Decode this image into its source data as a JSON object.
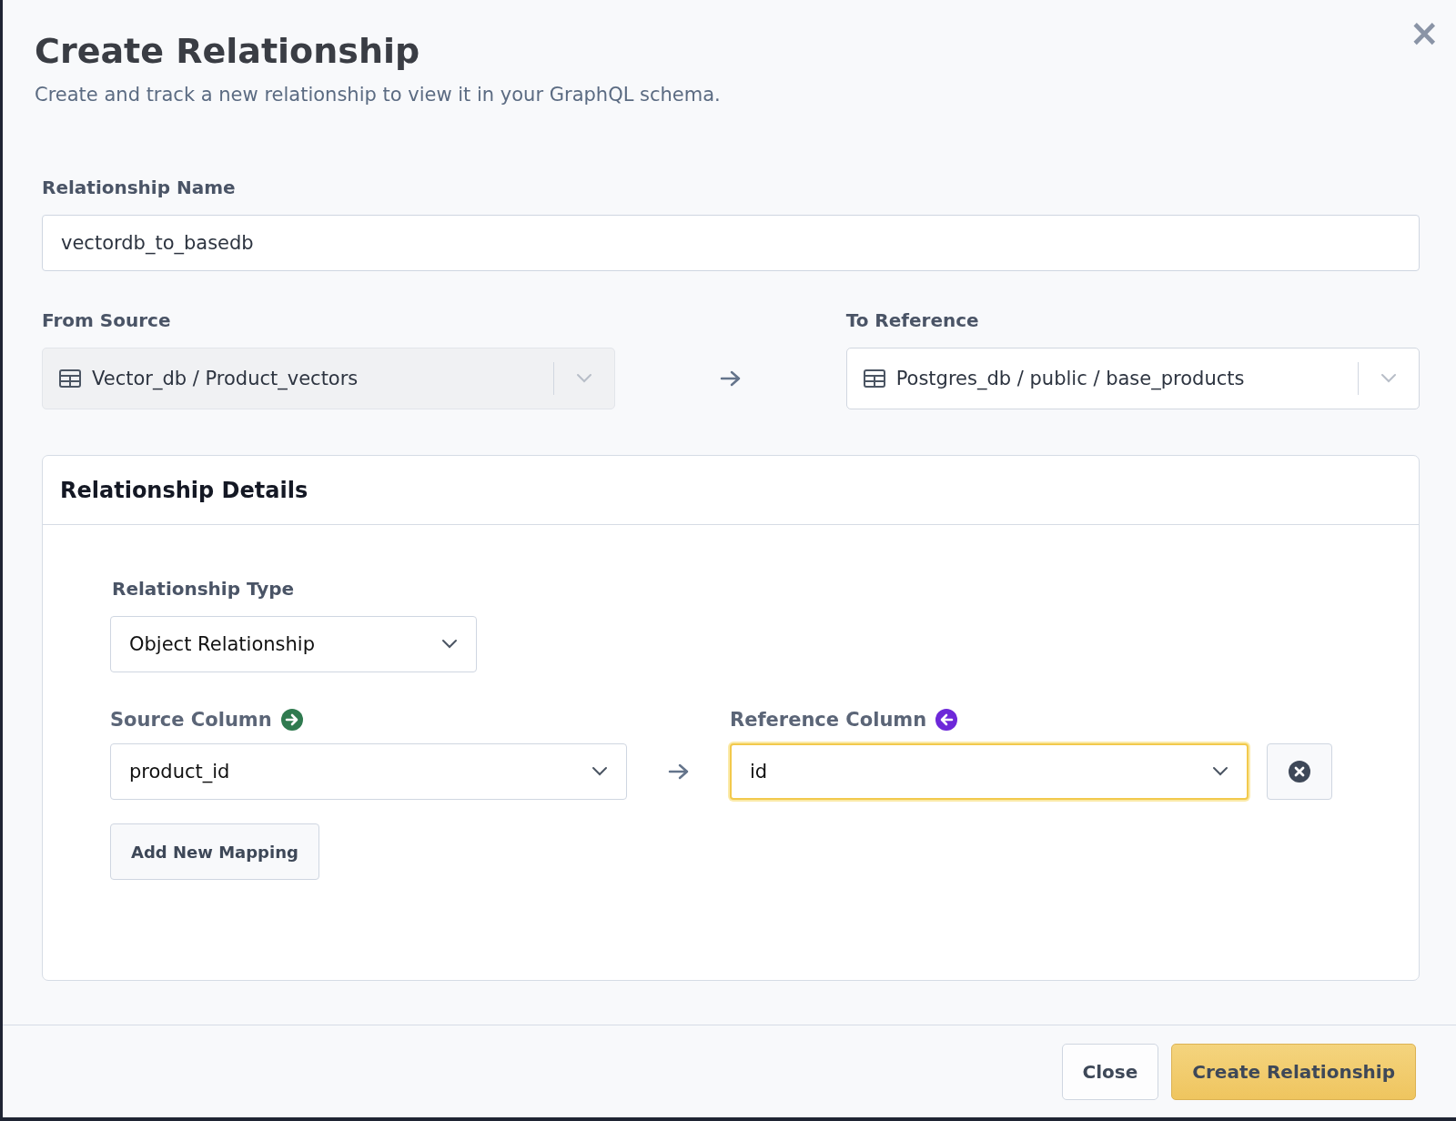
{
  "dialog": {
    "title": "Create Relationship",
    "subtitle": "Create and track a new relationship to view it in your GraphQL schema.",
    "close_icon": "×"
  },
  "relationship_name": {
    "label": "Relationship Name",
    "value": "vectordb_to_basedb"
  },
  "from_source": {
    "label": "From Source",
    "value": "Vector_db / Product_vectors",
    "disabled": true
  },
  "to_reference": {
    "label": "To Reference",
    "value": "Postgres_db / public / base_products",
    "disabled": false
  },
  "details": {
    "title": "Relationship Details",
    "relationship_type": {
      "label": "Relationship Type",
      "value": "Object Relationship"
    },
    "source_column": {
      "label": "Source Column",
      "value": "product_id",
      "focused": false
    },
    "reference_column": {
      "label": "Reference Column",
      "value": "id",
      "focused": true
    },
    "add_mapping": "Add New Mapping"
  },
  "buttons": [
    {
      "label": "Close",
      "kind": "secondary"
    },
    {
      "label": "Create Relationship",
      "kind": "primary"
    }
  ]
}
